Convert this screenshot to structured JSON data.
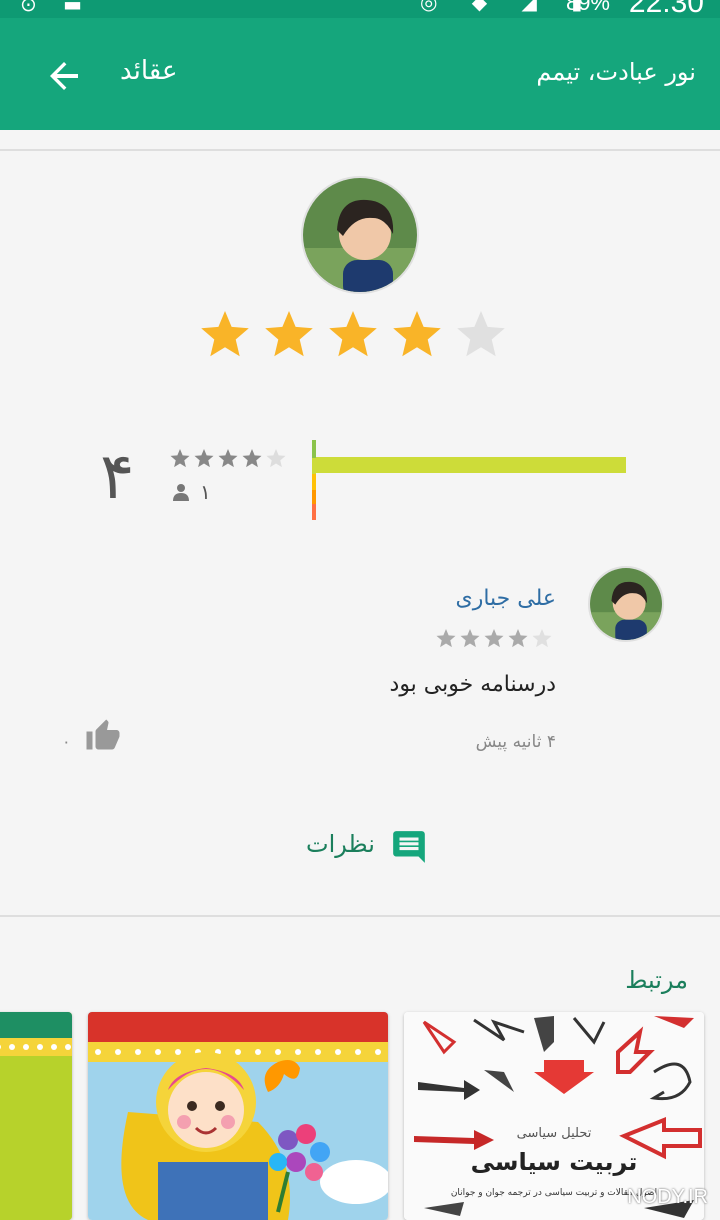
{
  "status_bar": {
    "clock": "22:30",
    "battery": "89%"
  },
  "app_bar": {
    "title": "عقائد",
    "subtitle": "نور عبادت، تیمم"
  },
  "overall_rating": {
    "stars": 4,
    "max_stars": 5,
    "score_text": "۴",
    "count_text": "۱",
    "bar_fraction": 1.0
  },
  "review": {
    "author": "علی جباری",
    "stars": 4,
    "text": "درسنامه خوبی بود",
    "time": "۴ ثانیه پیش",
    "likes": "۰"
  },
  "comments_button": {
    "label": "نظرات"
  },
  "related": {
    "title": "مرتبط",
    "book": {
      "subtitle": "تحلیل سیاسی",
      "title": "تربیت سیاسی",
      "desc": "اصول مقالات و تربیت سیاسی در ترجمه جوان و جوانان"
    }
  },
  "watermark": "NODY.IR",
  "colors": {
    "primary": "#15a67c",
    "star": "#f9b428",
    "star_empty": "#e0e0e0",
    "bar": "#cddc39"
  }
}
